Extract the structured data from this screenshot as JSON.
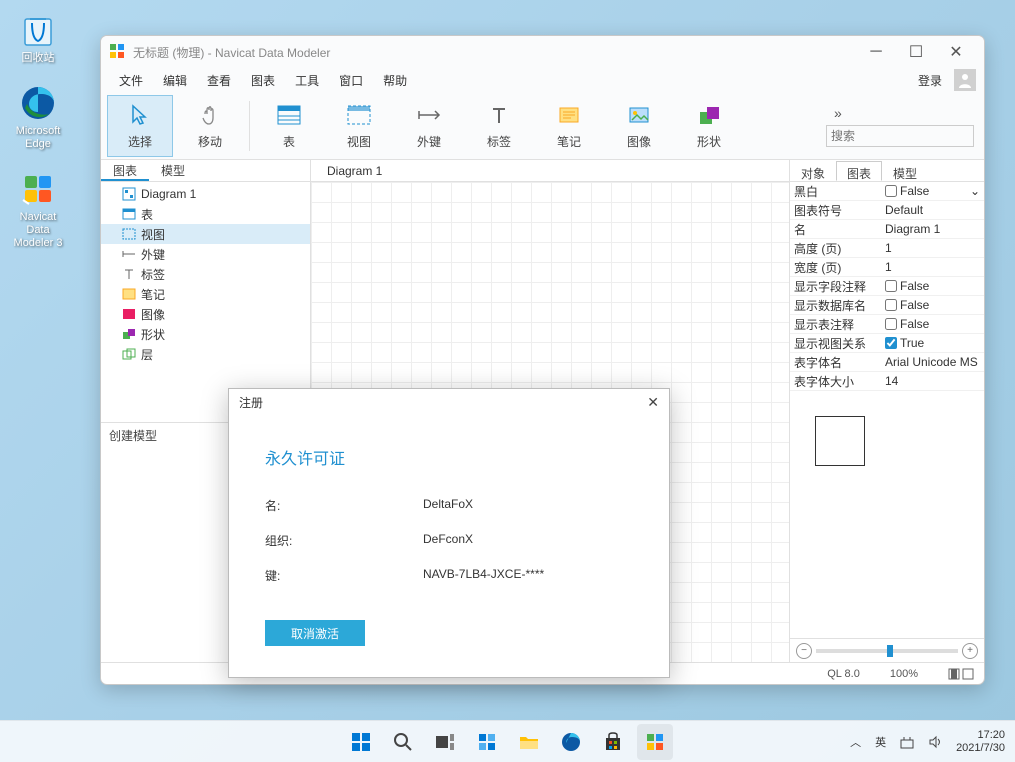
{
  "desktop": {
    "icons": [
      {
        "label": "回收站"
      },
      {
        "label": "Microsoft Edge"
      },
      {
        "label": "Navicat Data Modeler 3"
      }
    ]
  },
  "window": {
    "title": "无标题 (物理) - Navicat Data Modeler",
    "menu": [
      "文件",
      "编辑",
      "查看",
      "图表",
      "工具",
      "窗口",
      "帮助"
    ],
    "login": "登录",
    "toolbar": {
      "select": "选择",
      "move": "移动",
      "table": "表",
      "view": "视图",
      "fk": "外键",
      "label": "标签",
      "note": "笔记",
      "image": "图像",
      "shape": "形状"
    },
    "search_placeholder": "搜索",
    "left": {
      "tabs": [
        "图表",
        "模型"
      ],
      "tree": [
        "Diagram 1",
        "表",
        "视图",
        "外键",
        "标签",
        "笔记",
        "图像",
        "形状",
        "层"
      ],
      "create_model": "创建模型"
    },
    "canvas": {
      "tab": "Diagram 1"
    },
    "right": {
      "tabs": [
        "对象",
        "图表",
        "模型"
      ],
      "props": [
        {
          "k": "黑白",
          "v": "False",
          "cb": true,
          "checked": false,
          "dd": true
        },
        {
          "k": "图表符号",
          "v": "Default"
        },
        {
          "k": "名",
          "v": "Diagram 1"
        },
        {
          "k": "高度 (页)",
          "v": "1"
        },
        {
          "k": "宽度 (页)",
          "v": "1"
        },
        {
          "k": "显示字段注释",
          "v": "False",
          "cb": true,
          "checked": false
        },
        {
          "k": "显示数据库名",
          "v": "False",
          "cb": true,
          "checked": false
        },
        {
          "k": "显示表注释",
          "v": "False",
          "cb": true,
          "checked": false
        },
        {
          "k": "显示视图关系",
          "v": "True",
          "cb": true,
          "checked": true
        },
        {
          "k": "表字体名",
          "v": "Arial Unicode MS"
        },
        {
          "k": "表字体大小",
          "v": "14"
        }
      ]
    },
    "status": {
      "db": "QL 8.0",
      "zoom": "100%"
    }
  },
  "dialog": {
    "title": "注册",
    "heading": "永久许可证",
    "rows": [
      {
        "k": "名:",
        "v": "DeltaFoX"
      },
      {
        "k": "组织:",
        "v": "DeFconX"
      },
      {
        "k": "键:",
        "v": "NAVB-7LB4-JXCE-****"
      }
    ],
    "btn": "取消激活"
  },
  "taskbar": {
    "ime": "英",
    "time": "17:20",
    "date": "2021/7/30"
  }
}
